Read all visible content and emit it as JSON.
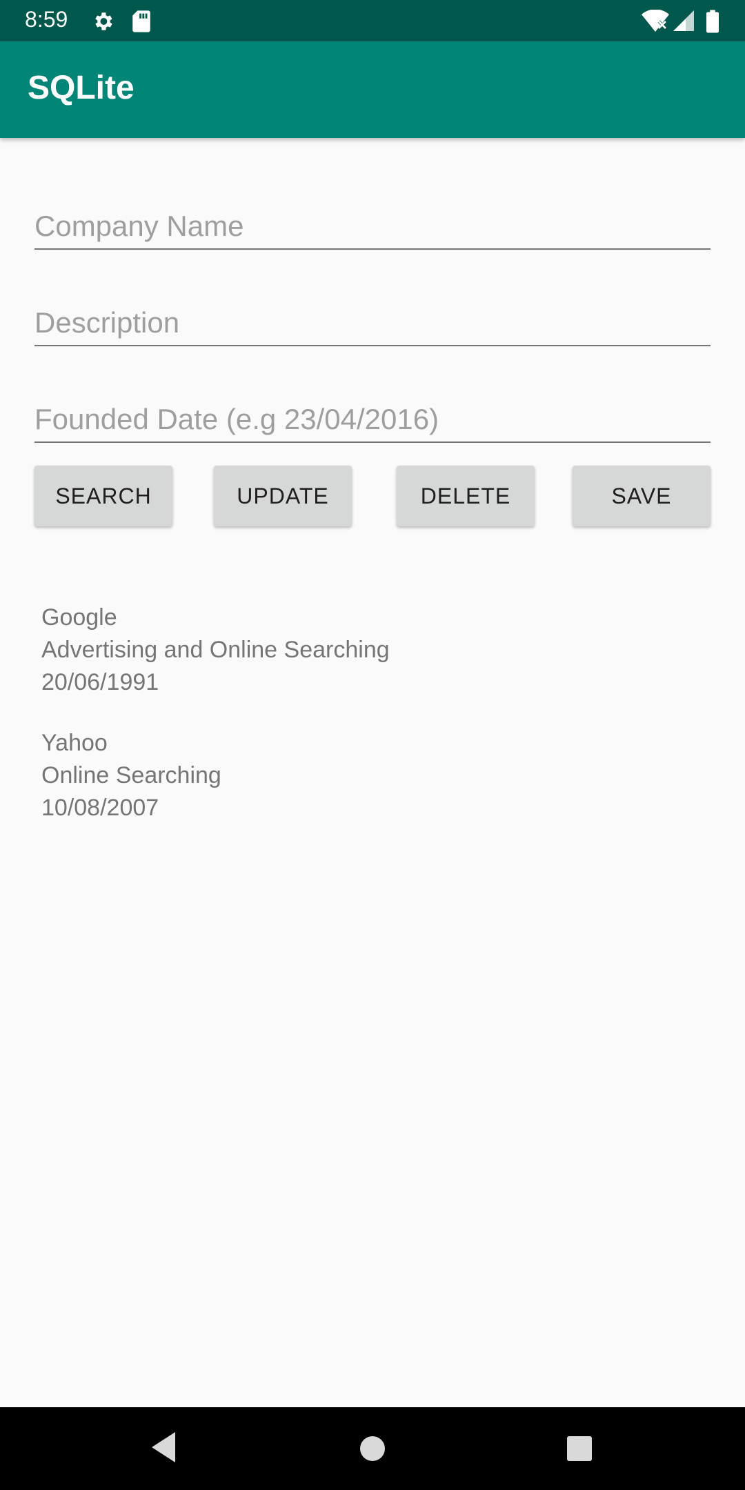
{
  "status_bar": {
    "time": "8:59",
    "icons": [
      "settings-icon",
      "sd-card-icon",
      "wifi-icon",
      "signal-icon",
      "battery-icon"
    ]
  },
  "app_bar": {
    "title": "SQLite"
  },
  "form": {
    "company_name": {
      "value": "",
      "placeholder": "Company Name"
    },
    "description": {
      "value": "",
      "placeholder": "Description"
    },
    "founded_date": {
      "value": "",
      "placeholder": "Founded Date (e.g 23/04/2016)"
    }
  },
  "buttons": {
    "search": "SEARCH",
    "update": "UPDATE",
    "delete": "DELETE",
    "save": "SAVE"
  },
  "results": [
    {
      "name": "Google",
      "description": "Advertising and Online Searching",
      "date": "20/06/1991"
    },
    {
      "name": "Yahoo",
      "description": "Online Searching",
      "date": "10/08/2007"
    }
  ],
  "nav_bar": {
    "icons": [
      "back-icon",
      "home-icon",
      "recents-icon"
    ]
  },
  "colors": {
    "status_bar": "#00574b",
    "app_bar": "#008577",
    "button": "#d6d7d7"
  }
}
